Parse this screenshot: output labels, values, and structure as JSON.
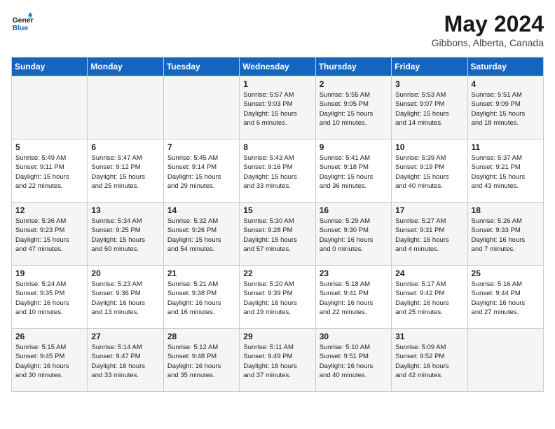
{
  "header": {
    "logo_line1": "General",
    "logo_line2": "Blue",
    "month_year": "May 2024",
    "location": "Gibbons, Alberta, Canada"
  },
  "days_of_week": [
    "Sunday",
    "Monday",
    "Tuesday",
    "Wednesday",
    "Thursday",
    "Friday",
    "Saturday"
  ],
  "weeks": [
    [
      {
        "num": "",
        "lines": []
      },
      {
        "num": "",
        "lines": []
      },
      {
        "num": "",
        "lines": []
      },
      {
        "num": "1",
        "lines": [
          "Sunrise: 5:57 AM",
          "Sunset: 9:03 PM",
          "Daylight: 15 hours",
          "and 6 minutes."
        ]
      },
      {
        "num": "2",
        "lines": [
          "Sunrise: 5:55 AM",
          "Sunset: 9:05 PM",
          "Daylight: 15 hours",
          "and 10 minutes."
        ]
      },
      {
        "num": "3",
        "lines": [
          "Sunrise: 5:53 AM",
          "Sunset: 9:07 PM",
          "Daylight: 15 hours",
          "and 14 minutes."
        ]
      },
      {
        "num": "4",
        "lines": [
          "Sunrise: 5:51 AM",
          "Sunset: 9:09 PM",
          "Daylight: 15 hours",
          "and 18 minutes."
        ]
      }
    ],
    [
      {
        "num": "5",
        "lines": [
          "Sunrise: 5:49 AM",
          "Sunset: 9:11 PM",
          "Daylight: 15 hours",
          "and 22 minutes."
        ]
      },
      {
        "num": "6",
        "lines": [
          "Sunrise: 5:47 AM",
          "Sunset: 9:12 PM",
          "Daylight: 15 hours",
          "and 25 minutes."
        ]
      },
      {
        "num": "7",
        "lines": [
          "Sunrise: 5:45 AM",
          "Sunset: 9:14 PM",
          "Daylight: 15 hours",
          "and 29 minutes."
        ]
      },
      {
        "num": "8",
        "lines": [
          "Sunrise: 5:43 AM",
          "Sunset: 9:16 PM",
          "Daylight: 15 hours",
          "and 33 minutes."
        ]
      },
      {
        "num": "9",
        "lines": [
          "Sunrise: 5:41 AM",
          "Sunset: 9:18 PM",
          "Daylight: 15 hours",
          "and 36 minutes."
        ]
      },
      {
        "num": "10",
        "lines": [
          "Sunrise: 5:39 AM",
          "Sunset: 9:19 PM",
          "Daylight: 15 hours",
          "and 40 minutes."
        ]
      },
      {
        "num": "11",
        "lines": [
          "Sunrise: 5:37 AM",
          "Sunset: 9:21 PM",
          "Daylight: 15 hours",
          "and 43 minutes."
        ]
      }
    ],
    [
      {
        "num": "12",
        "lines": [
          "Sunrise: 5:36 AM",
          "Sunset: 9:23 PM",
          "Daylight: 15 hours",
          "and 47 minutes."
        ]
      },
      {
        "num": "13",
        "lines": [
          "Sunrise: 5:34 AM",
          "Sunset: 9:25 PM",
          "Daylight: 15 hours",
          "and 50 minutes."
        ]
      },
      {
        "num": "14",
        "lines": [
          "Sunrise: 5:32 AM",
          "Sunset: 9:26 PM",
          "Daylight: 15 hours",
          "and 54 minutes."
        ]
      },
      {
        "num": "15",
        "lines": [
          "Sunrise: 5:30 AM",
          "Sunset: 9:28 PM",
          "Daylight: 15 hours",
          "and 57 minutes."
        ]
      },
      {
        "num": "16",
        "lines": [
          "Sunrise: 5:29 AM",
          "Sunset: 9:30 PM",
          "Daylight: 16 hours",
          "and 0 minutes."
        ]
      },
      {
        "num": "17",
        "lines": [
          "Sunrise: 5:27 AM",
          "Sunset: 9:31 PM",
          "Daylight: 16 hours",
          "and 4 minutes."
        ]
      },
      {
        "num": "18",
        "lines": [
          "Sunrise: 5:26 AM",
          "Sunset: 9:33 PM",
          "Daylight: 16 hours",
          "and 7 minutes."
        ]
      }
    ],
    [
      {
        "num": "19",
        "lines": [
          "Sunrise: 5:24 AM",
          "Sunset: 9:35 PM",
          "Daylight: 16 hours",
          "and 10 minutes."
        ]
      },
      {
        "num": "20",
        "lines": [
          "Sunrise: 5:23 AM",
          "Sunset: 9:36 PM",
          "Daylight: 16 hours",
          "and 13 minutes."
        ]
      },
      {
        "num": "21",
        "lines": [
          "Sunrise: 5:21 AM",
          "Sunset: 9:38 PM",
          "Daylight: 16 hours",
          "and 16 minutes."
        ]
      },
      {
        "num": "22",
        "lines": [
          "Sunrise: 5:20 AM",
          "Sunset: 9:39 PM",
          "Daylight: 16 hours",
          "and 19 minutes."
        ]
      },
      {
        "num": "23",
        "lines": [
          "Sunrise: 5:18 AM",
          "Sunset: 9:41 PM",
          "Daylight: 16 hours",
          "and 22 minutes."
        ]
      },
      {
        "num": "24",
        "lines": [
          "Sunrise: 5:17 AM",
          "Sunset: 9:42 PM",
          "Daylight: 16 hours",
          "and 25 minutes."
        ]
      },
      {
        "num": "25",
        "lines": [
          "Sunrise: 5:16 AM",
          "Sunset: 9:44 PM",
          "Daylight: 16 hours",
          "and 27 minutes."
        ]
      }
    ],
    [
      {
        "num": "26",
        "lines": [
          "Sunrise: 5:15 AM",
          "Sunset: 9:45 PM",
          "Daylight: 16 hours",
          "and 30 minutes."
        ]
      },
      {
        "num": "27",
        "lines": [
          "Sunrise: 5:14 AM",
          "Sunset: 9:47 PM",
          "Daylight: 16 hours",
          "and 33 minutes."
        ]
      },
      {
        "num": "28",
        "lines": [
          "Sunrise: 5:12 AM",
          "Sunset: 9:48 PM",
          "Daylight: 16 hours",
          "and 35 minutes."
        ]
      },
      {
        "num": "29",
        "lines": [
          "Sunrise: 5:11 AM",
          "Sunset: 9:49 PM",
          "Daylight: 16 hours",
          "and 37 minutes."
        ]
      },
      {
        "num": "30",
        "lines": [
          "Sunrise: 5:10 AM",
          "Sunset: 9:51 PM",
          "Daylight: 16 hours",
          "and 40 minutes."
        ]
      },
      {
        "num": "31",
        "lines": [
          "Sunrise: 5:09 AM",
          "Sunset: 9:52 PM",
          "Daylight: 16 hours",
          "and 42 minutes."
        ]
      },
      {
        "num": "",
        "lines": []
      }
    ]
  ]
}
